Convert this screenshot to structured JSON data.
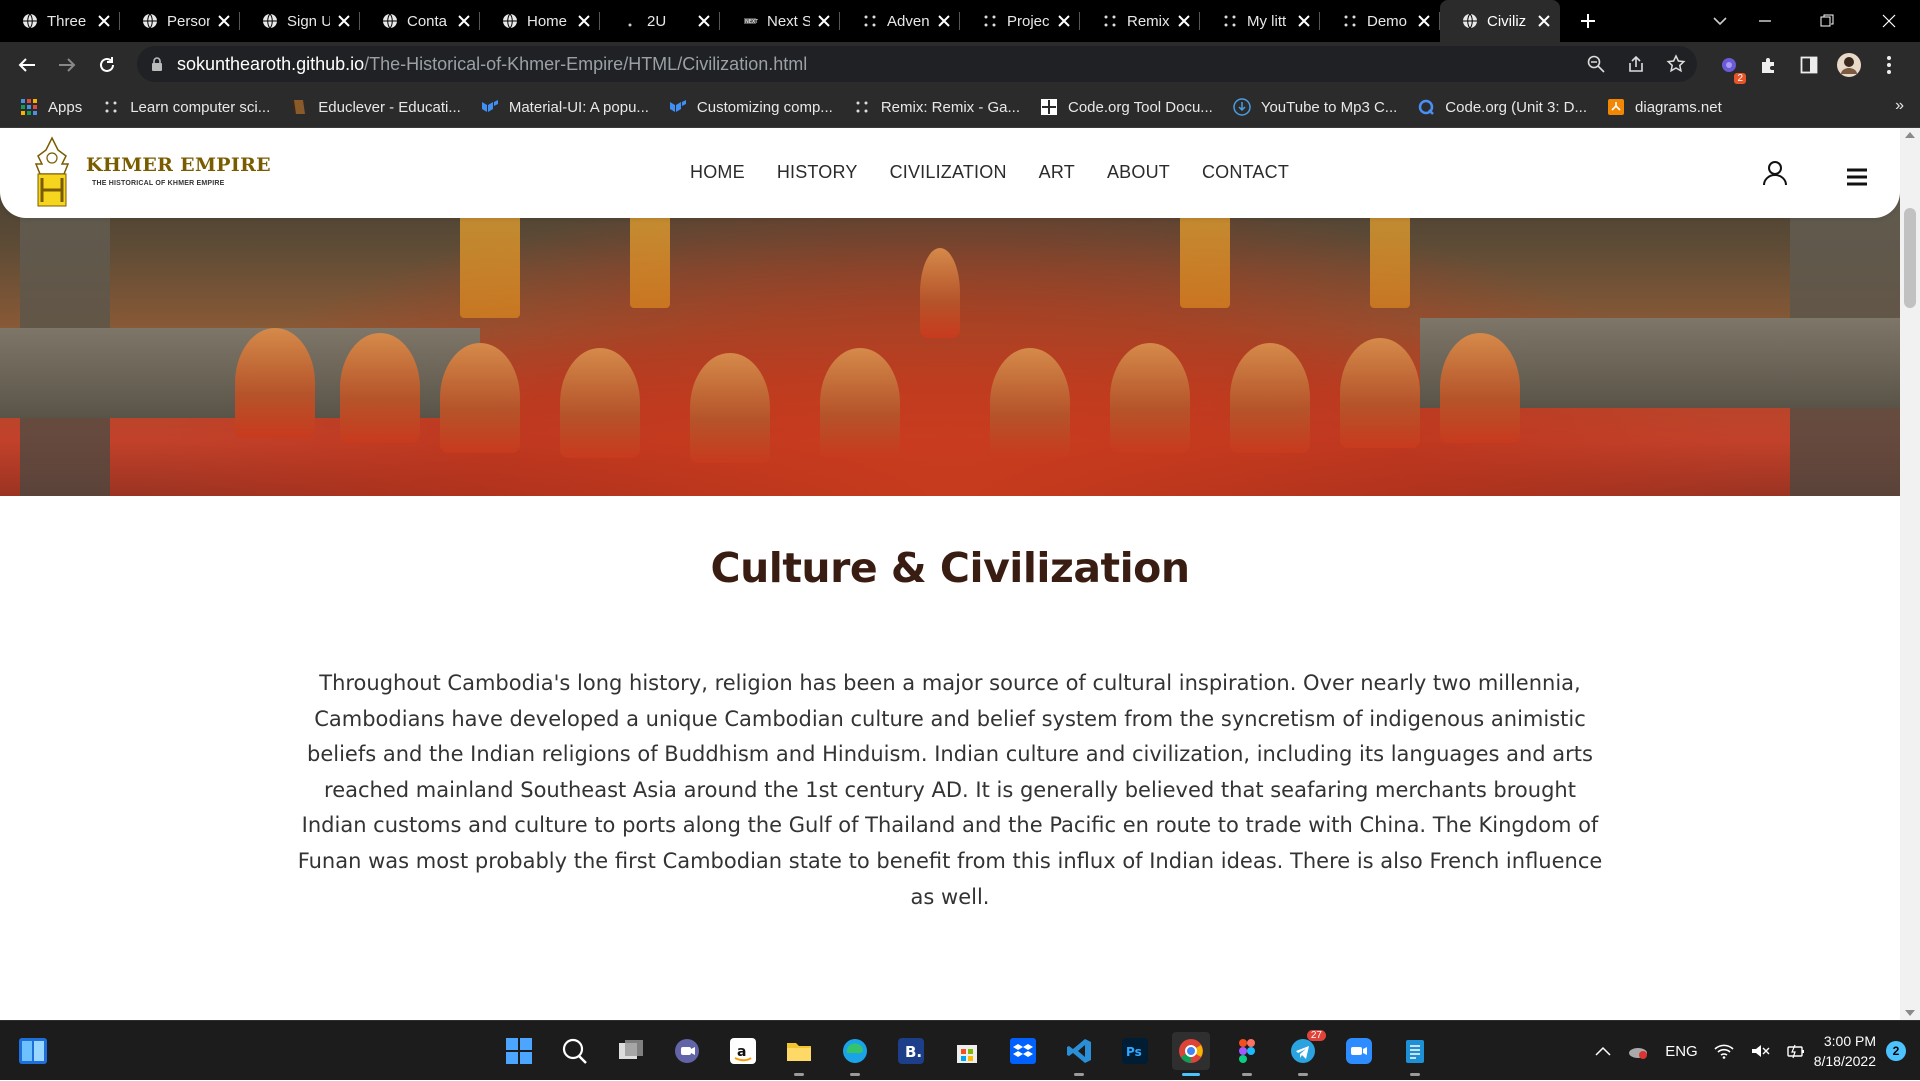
{
  "browser": {
    "tabs": [
      {
        "title": "Three",
        "icon": "globe-icon"
      },
      {
        "title": "Person",
        "icon": "globe-icon"
      },
      {
        "title": "Sign U",
        "icon": "globe-icon"
      },
      {
        "title": "Conta",
        "icon": "globe-icon"
      },
      {
        "title": "Home",
        "icon": "globe-icon"
      },
      {
        "title": "2U",
        "icon": "dot-icon"
      },
      {
        "title": "Next S",
        "icon": "nextjs-icon"
      },
      {
        "title": "Adven",
        "icon": "dots-grid-icon"
      },
      {
        "title": "Projec",
        "icon": "dots-grid-icon"
      },
      {
        "title": "Remix",
        "icon": "dots-grid-icon"
      },
      {
        "title": "My litt",
        "icon": "dots-grid-icon"
      },
      {
        "title": "Demo",
        "icon": "dots-grid-icon"
      },
      {
        "title": "Civiliz",
        "icon": "globe-icon",
        "active": true
      }
    ],
    "url_host": "sokunthearoth.github.io",
    "url_path": "/The-Historical-of-Khmer-Empire/HTML/Civilization.html",
    "extension_badge": "2",
    "bookmarks": [
      {
        "label": "Apps",
        "icon": "apps-grid-icon"
      },
      {
        "label": "Learn computer sci...",
        "icon": "dots-grid-icon"
      },
      {
        "label": "Educlever - Educati...",
        "icon": "book-icon"
      },
      {
        "label": "Material-UI: A popu...",
        "icon": "mui-icon"
      },
      {
        "label": "Customizing comp...",
        "icon": "mui-icon"
      },
      {
        "label": "Remix: Remix - Ga...",
        "icon": "dots-grid-icon"
      },
      {
        "label": "Code.org Tool Docu...",
        "icon": "codeorg-icon"
      },
      {
        "label": "YouTube to Mp3 C...",
        "icon": "download-icon"
      },
      {
        "label": "Code.org (Unit 3: D...",
        "icon": "search-q-icon"
      },
      {
        "label": "diagrams.net",
        "icon": "diagrams-icon"
      }
    ],
    "bookmarks_more": "»"
  },
  "site": {
    "brand": "KHMER EMPIRE",
    "brand_sub": "THE HISTORICAL OF KHMER EMPIRE",
    "nav": [
      "HOME",
      "HISTORY",
      "CIVILIZATION",
      "ART",
      "ABOUT",
      "CONTACT"
    ],
    "section_title": "Culture & Civilization",
    "section_text": "Throughout Cambodia's long history, religion has been a major source of cultural inspiration. Over nearly two millennia, Cambodians have developed a unique Cambodian culture and belief system from the syncretism of indigenous animistic beliefs and the Indian religions of Buddhism and Hinduism. Indian culture and civilization, including its languages and arts reached mainland Southeast Asia around the 1st century AD. It is generally believed that seafaring merchants brought Indian customs and culture to ports along the Gulf of Thailand and the Pacific en route to trade with China. The Kingdom of Funan was most probably the first Cambodian state to benefit from this influx of Indian ideas. There is also French influence as well."
  },
  "taskbar": {
    "language": "ENG",
    "time": "3:00 PM",
    "date": "8/18/2022",
    "notification_count": "2",
    "telegram_badge": "27",
    "apps": [
      "windows-start-icon",
      "search-icon",
      "task-view-icon",
      "chat-icon",
      "amazon-icon",
      "file-explorer-icon",
      "edge-icon",
      "b-app-icon",
      "store-icon",
      "dropbox-icon",
      "vscode-icon",
      "photoshop-icon",
      "chrome-icon",
      "figma-icon",
      "telegram-icon",
      "zoom-icon",
      "notepad-icon"
    ]
  }
}
